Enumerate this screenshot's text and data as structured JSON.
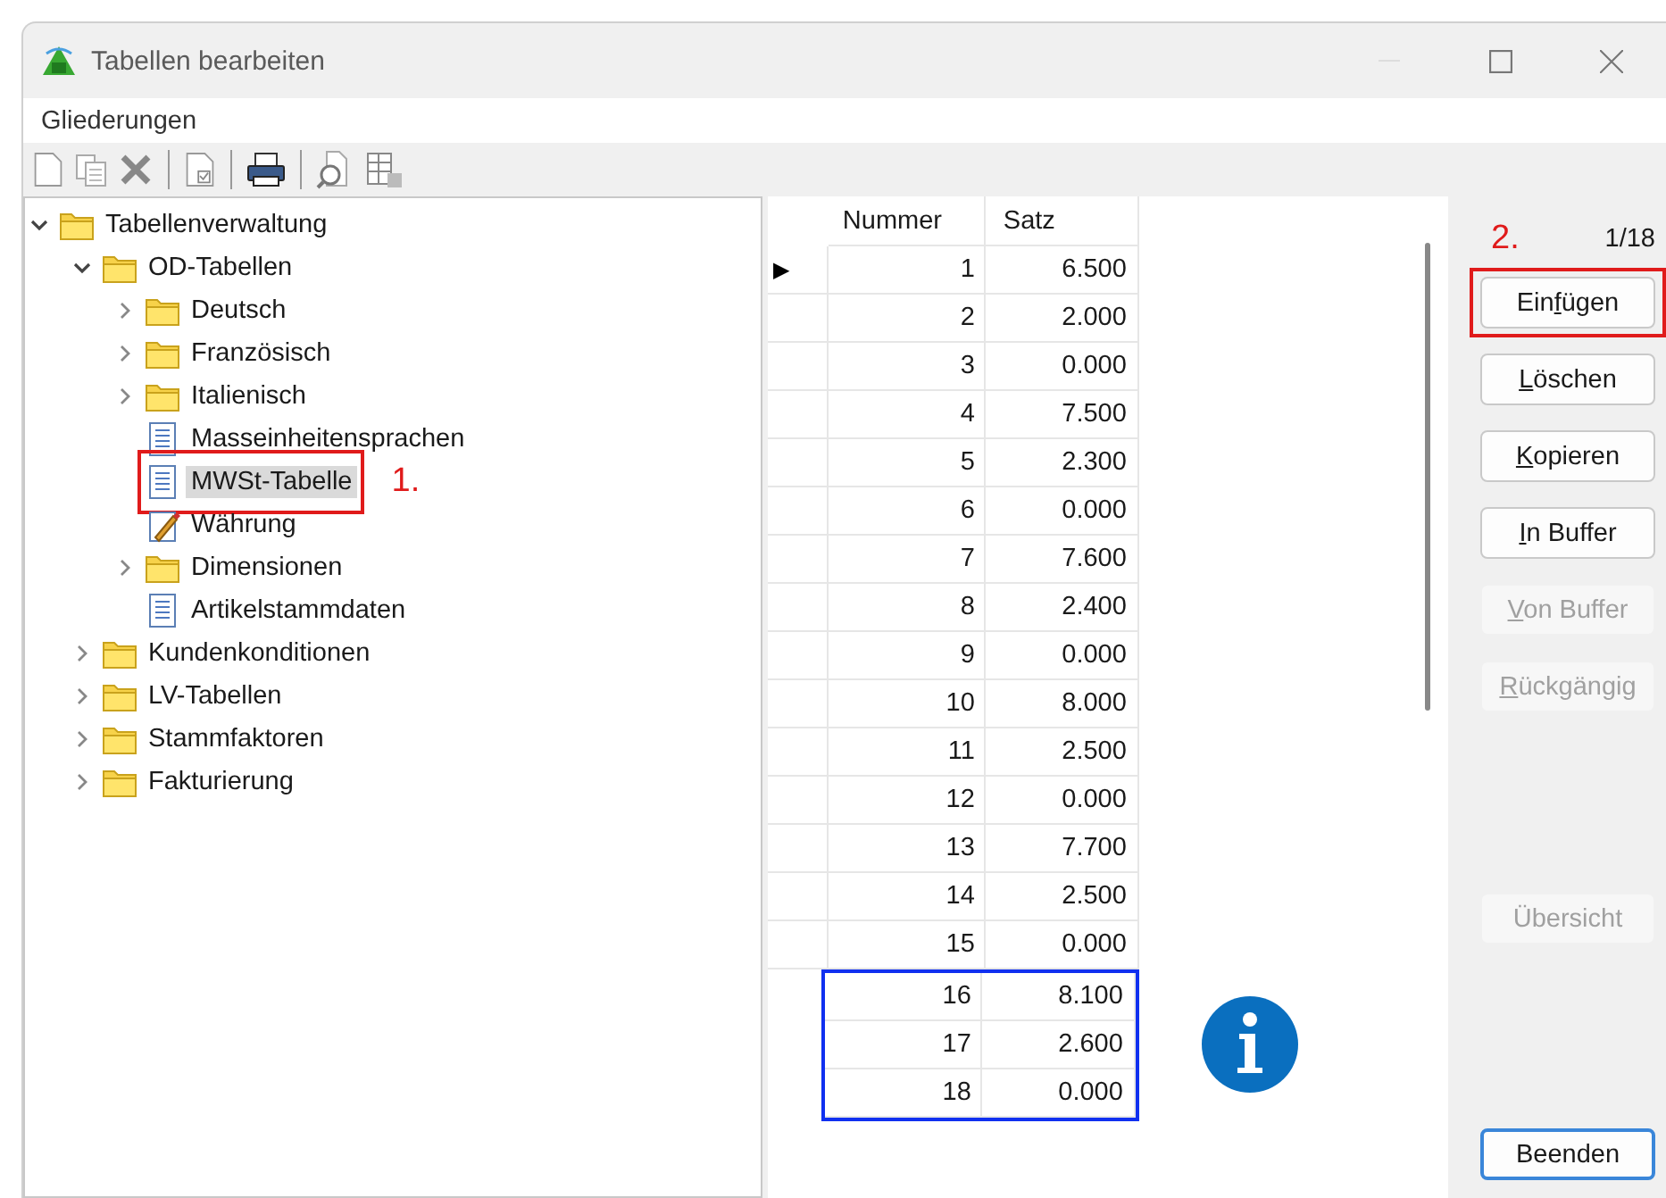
{
  "window": {
    "title": "Tabellen bearbeiten"
  },
  "menu": [
    "Gliederungen"
  ],
  "toolbar": [
    {
      "kind": "new"
    },
    {
      "kind": "copy"
    },
    {
      "kind": "delete"
    },
    {
      "kind": "separator"
    },
    {
      "kind": "check"
    },
    {
      "kind": "separator"
    },
    {
      "kind": "print"
    },
    {
      "kind": "separator"
    },
    {
      "kind": "find"
    },
    {
      "kind": "export"
    }
  ],
  "tree": [
    {
      "label": "Tabellenverwaltung",
      "kind": "folder",
      "expanded": true,
      "selected": false,
      "children": [
        {
          "label": "OD-Tabellen",
          "kind": "folder",
          "expanded": true,
          "selected": false,
          "children": [
            {
              "label": "Deutsch",
              "kind": "folder",
              "expanded": false,
              "selected": false
            },
            {
              "label": "Französisch",
              "kind": "folder",
              "expanded": false,
              "selected": false
            },
            {
              "label": "Italienisch",
              "kind": "folder",
              "expanded": false,
              "selected": false
            },
            {
              "label": "Masseinheitensprachen",
              "kind": "document",
              "selected": false
            },
            {
              "label": "MWSt-Tabelle",
              "kind": "document",
              "selected": true,
              "annotation": "1."
            },
            {
              "label": "Währung",
              "kind": "edit",
              "selected": false
            },
            {
              "label": "Dimensionen",
              "kind": "folder",
              "expanded": false,
              "selected": false
            },
            {
              "label": "Artikelstammdaten",
              "kind": "document",
              "selected": false
            }
          ]
        },
        {
          "label": "Kundenkonditionen",
          "kind": "folder",
          "expanded": false,
          "selected": false
        },
        {
          "label": "LV-Tabellen",
          "kind": "folder",
          "expanded": false,
          "selected": false
        },
        {
          "label": "Stammfaktoren",
          "kind": "folder",
          "expanded": false,
          "selected": false
        },
        {
          "label": "Fakturierung",
          "kind": "folder",
          "expanded": false,
          "selected": false
        }
      ]
    }
  ],
  "table": {
    "columns": [
      "Nummer",
      "Satz"
    ],
    "rows": [
      {
        "pointer": "▶",
        "cells": [
          "1",
          "6.500"
        ],
        "highlighted": false
      },
      {
        "cells": [
          "2",
          "2.000"
        ],
        "highlighted": false
      },
      {
        "cells": [
          "3",
          "0.000"
        ],
        "highlighted": false
      },
      {
        "cells": [
          "4",
          "7.500"
        ],
        "highlighted": false
      },
      {
        "cells": [
          "5",
          "2.300"
        ],
        "highlighted": false
      },
      {
        "cells": [
          "6",
          "0.000"
        ],
        "highlighted": false
      },
      {
        "cells": [
          "7",
          "7.600"
        ],
        "highlighted": false
      },
      {
        "cells": [
          "8",
          "2.400"
        ],
        "highlighted": false
      },
      {
        "cells": [
          "9",
          "0.000"
        ],
        "highlighted": false
      },
      {
        "cells": [
          "10",
          "8.000"
        ],
        "highlighted": false
      },
      {
        "cells": [
          "11",
          "2.500"
        ],
        "highlighted": false
      },
      {
        "cells": [
          "12",
          "0.000"
        ],
        "highlighted": false
      },
      {
        "cells": [
          "13",
          "7.700"
        ],
        "highlighted": false
      },
      {
        "cells": [
          "14",
          "2.500"
        ],
        "highlighted": false
      },
      {
        "cells": [
          "15",
          "0.000"
        ],
        "highlighted": false
      },
      {
        "cells": [
          "16",
          "8.100"
        ],
        "highlighted": true
      },
      {
        "cells": [
          "17",
          "2.600"
        ],
        "highlighted": true
      },
      {
        "cells": [
          "18",
          "0.000"
        ],
        "highlighted": true
      }
    ]
  },
  "record_counter": "1/18",
  "button_annotation": "2.",
  "button_groups": [
    [
      {
        "label_before": "Ein",
        "access_key": "f",
        "label_after": "ügen",
        "disabled": false,
        "default": false,
        "annotated": true
      },
      {
        "access_key": "L",
        "label_after": "öschen",
        "disabled": false,
        "default": false,
        "annotated": false
      },
      {
        "access_key": "K",
        "label_after": "opieren",
        "disabled": false,
        "default": false,
        "annotated": false
      },
      {
        "access_key": "I",
        "label_after": "n Buffer",
        "disabled": false,
        "default": false,
        "annotated": false
      },
      {
        "access_key": "V",
        "label_after": "on Buffer",
        "disabled": true,
        "default": false,
        "annotated": false
      },
      {
        "access_key": "R",
        "label_after": "ückgängig",
        "disabled": true,
        "default": false,
        "annotated": false
      }
    ],
    [
      {
        "label": "Übersicht",
        "disabled": true,
        "default": false,
        "annotated": false
      }
    ],
    [
      {
        "label": "Beenden",
        "disabled": false,
        "default": true,
        "annotated": false
      }
    ]
  ]
}
